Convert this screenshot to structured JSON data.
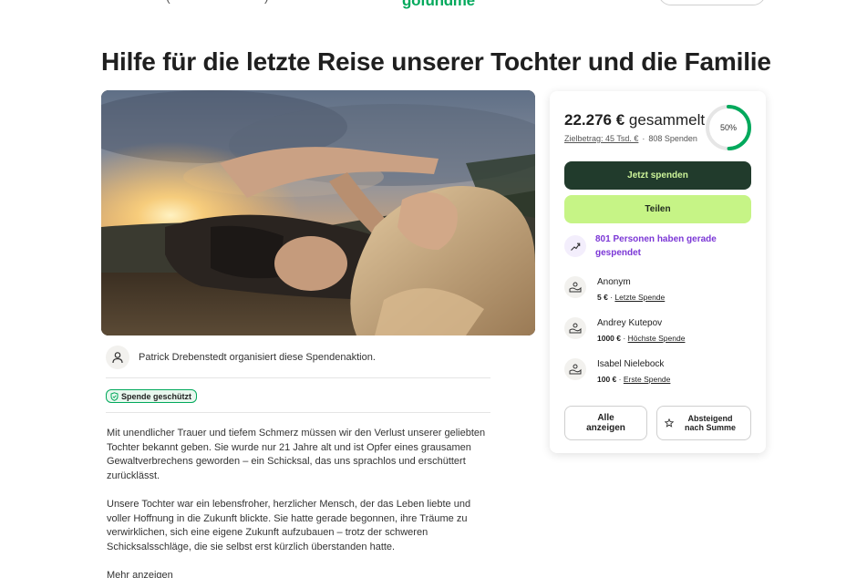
{
  "header": {
    "logo": "gofundme",
    "nav_fragment_left": "(",
    "nav_fragment_right": ")"
  },
  "campaign": {
    "title": "Hilfe für die letzte Reise unserer Tochter und die Familie",
    "image_alt": "Junge Frau liegt im Gras bei Sonnenuntergang",
    "organizer_text": "Patrick Drebenstedt organisiert diese Spendenaktion.",
    "badge": "Spende geschützt",
    "story": [
      "Mit unendlicher Trauer und tiefem Schmerz müssen wir den Verlust unserer geliebten Tochter bekannt geben. Sie wurde nur 21 Jahre alt und ist Opfer eines grausamen Gewaltverbrechens geworden – ein Schicksal, das uns sprachlos und erschüttert zurücklässt.",
      "Unsere Tochter war ein lebensfroher, herzlicher Mensch, der das Leben liebte und voller Hoffnung in die Zukunft blickte. Sie hatte gerade begonnen, ihre Träume zu verwirklichen, sich eine eigene Zukunft aufzubauen – trotz der schweren Schicksalsschläge, die sie selbst erst kürzlich überstanden hatte."
    ],
    "more_link": "Mehr anzeigen"
  },
  "card": {
    "raised_amount": "22.276 €",
    "raised_label": "gesammelt",
    "goal": "Zielbetrag: 45 Tsd. €",
    "separator": "·",
    "donation_count": "808 Spenden",
    "progress_label": "50%",
    "progress_fraction": 0.495,
    "donate_button": "Jetzt spenden",
    "share_button": "Teilen",
    "trending": "801 Personen haben gerade gespendet",
    "donors": [
      {
        "name": "Anonym",
        "amount": "5 €",
        "tag": "Letzte Spende"
      },
      {
        "name": "Andrey Kutepov",
        "amount": "1000 €",
        "tag": "Höchste Spende"
      },
      {
        "name": "Isabel Nielebock",
        "amount": "100 €",
        "tag": "Erste Spende"
      }
    ],
    "donor_sep": "·",
    "see_all_button": "Alle anzeigen",
    "sort_button": "Absteigend nach Summe"
  },
  "colors": {
    "brand_green": "#02a95c",
    "donate_bg": "#213b2c",
    "share_bg": "#c6f486",
    "trend_purple": "#7b37d6",
    "progress_green": "#02a95c"
  }
}
